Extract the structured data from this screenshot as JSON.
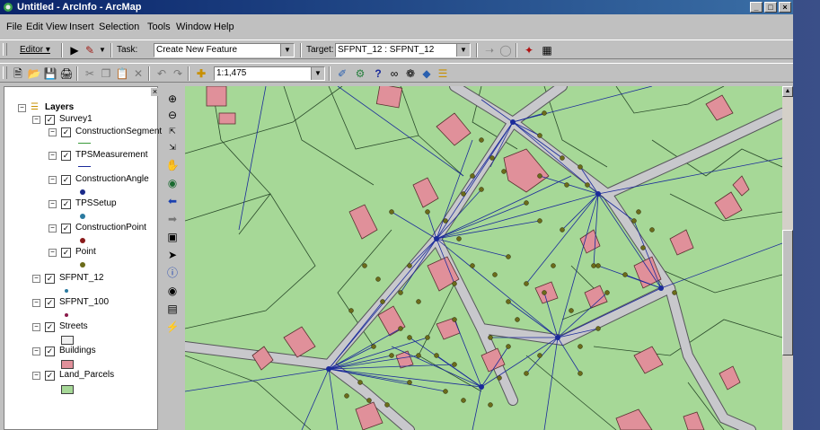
{
  "window": {
    "title": "Untitled - ArcInfo - ArcMap",
    "controls": [
      "_",
      "□",
      "×"
    ]
  },
  "menu": {
    "items": [
      "File",
      "Edit",
      "View",
      "Insert",
      "Selection",
      "Tools",
      "Window",
      "Help"
    ]
  },
  "editor_toolbar": {
    "editor_label": "Editor ▾",
    "task_label": "Task:",
    "task_value": "Create New Feature",
    "target_label": "Target:",
    "target_value": "SFPNT_12 : SFPNT_12"
  },
  "standard_toolbar": {
    "scale_value": "1:1,475"
  },
  "toc": {
    "root": "Layers",
    "group": "Survey1",
    "survey_layers": [
      "ConstructionSegment",
      "TPSMeasurement",
      "ConstructionAngle",
      "TPSSetup",
      "ConstructionPoint",
      "Point"
    ],
    "layers": [
      "SFPNT_12",
      "SFPNT_100",
      "Streets",
      "Buildings",
      "Land_Parcels"
    ],
    "close": "×"
  },
  "colors": {
    "parcel_fill": "#a6d897",
    "building_fill": "#e0909a",
    "street_fill": "#c8c8cc",
    "measurement_line": "#1a2a9a",
    "point_fill": "#6b6b1a",
    "title_bar": "#0a246a"
  },
  "icons": {
    "map_tools": [
      "zoom-in-icon",
      "zoom-out-icon",
      "fixed-zoom-in-icon",
      "fixed-zoom-out-icon",
      "pan-icon",
      "full-extent-icon",
      "back-extent-icon",
      "forward-extent-icon",
      "select-elements-icon",
      "select-arrow-icon",
      "identify-icon",
      "find-icon",
      "measure-icon",
      "hyperlink-icon"
    ]
  }
}
